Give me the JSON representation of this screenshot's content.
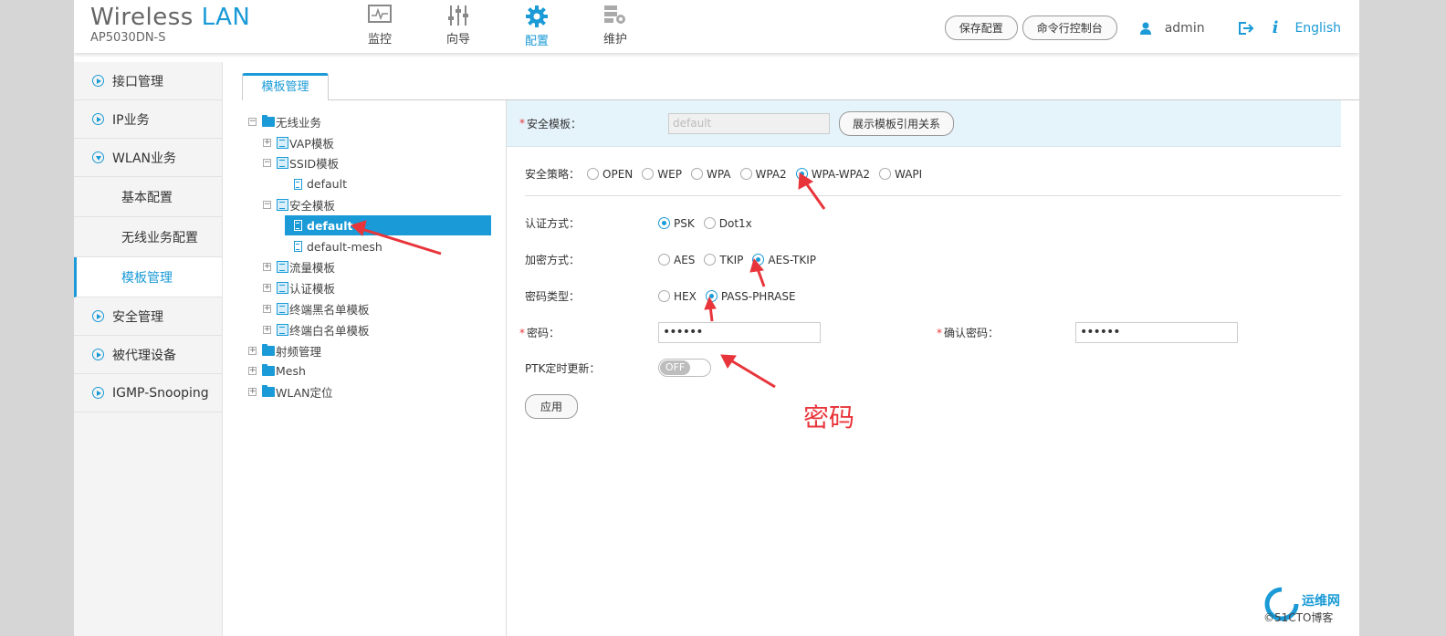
{
  "header": {
    "brand_main": "Wireless",
    "brand_accent": "LAN",
    "model": "AP5030DN-S",
    "nav": [
      {
        "label": "监控",
        "icon": "monitor-icon"
      },
      {
        "label": "向导",
        "icon": "wizard-sliders-icon"
      },
      {
        "label": "配置",
        "icon": "gear-icon"
      },
      {
        "label": "维护",
        "icon": "maintenance-icon"
      }
    ],
    "active_nav": "配置",
    "save_button": "保存配置",
    "console_button": "命令行控制台",
    "username": "admin",
    "language": "English",
    "accent_color": "#1a9ad6"
  },
  "sidebar": {
    "items": [
      {
        "label": "接口管理"
      },
      {
        "label": "IP业务"
      },
      {
        "label": "WLAN业务"
      },
      {
        "label": "基本配置"
      },
      {
        "label": "无线业务配置"
      },
      {
        "label": "模板管理"
      },
      {
        "label": "安全管理"
      },
      {
        "label": "被代理设备"
      },
      {
        "label": "IGMP-Snooping"
      }
    ]
  },
  "tab": {
    "label": "模板管理"
  },
  "tree": {
    "nodes": [
      {
        "label": "无线业务"
      },
      {
        "label": "VAP模板"
      },
      {
        "label": "SSID模板"
      },
      {
        "label": "default"
      },
      {
        "label": "安全模板"
      },
      {
        "label": "default"
      },
      {
        "label": "default-mesh"
      },
      {
        "label": "流量模板"
      },
      {
        "label": "认证模板"
      },
      {
        "label": "终端黑名单模板"
      },
      {
        "label": "终端白名单模板"
      },
      {
        "label": "射频管理"
      },
      {
        "label": "Mesh"
      },
      {
        "label": "WLAN定位"
      }
    ]
  },
  "form": {
    "security_profile_label": "安全模板：",
    "security_profile_value": "default",
    "show_refs_button": "展示模板引用关系",
    "policy_label": "安全策略：",
    "policy_options": [
      "OPEN",
      "WEP",
      "WPA",
      "WPA2",
      "WPA-WPA2",
      "WAPI"
    ],
    "policy_selected": "WPA-WPA2",
    "auth_label": "认证方式：",
    "auth_options": [
      "PSK",
      "Dot1x"
    ],
    "auth_selected": "PSK",
    "encrypt_label": "加密方式：",
    "encrypt_options": [
      "AES",
      "TKIP",
      "AES-TKIP"
    ],
    "encrypt_selected": "AES-TKIP",
    "pwd_type_label": "密码类型：",
    "pwd_type_options": [
      "HEX",
      "PASS-PHRASE"
    ],
    "pwd_type_selected": "PASS-PHRASE",
    "password_label": "密码：",
    "password_value": "••••••",
    "confirm_label": "确认密码：",
    "confirm_value": "••••••",
    "ptk_label": "PTK定时更新：",
    "ptk_toggle": "OFF",
    "apply_button": "应用"
  },
  "annotation": {
    "text": "密码",
    "color": "#e8353b"
  },
  "watermark": {
    "cn": "运维网",
    "en": "©51CTO博客"
  }
}
